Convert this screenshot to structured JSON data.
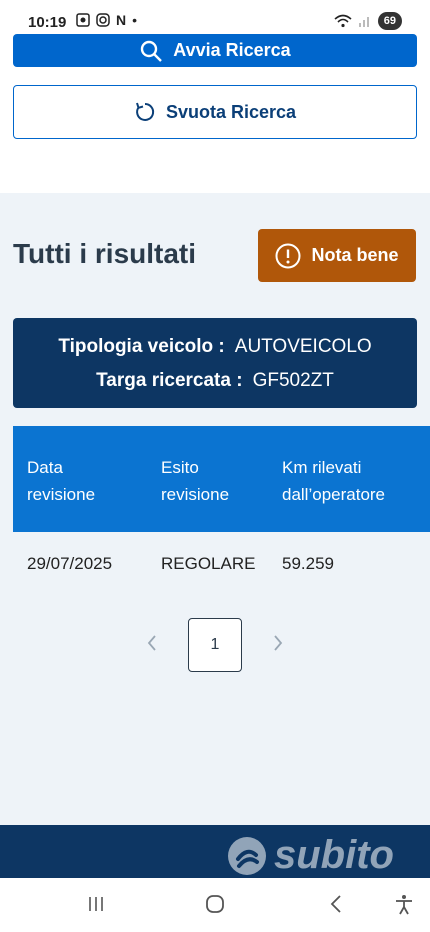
{
  "status_bar": {
    "time": "10:19",
    "notification_letter": "N",
    "notification_dot": "•",
    "battery": "69"
  },
  "search": {
    "start_label": "Avvia Ricerca",
    "clear_label": "Svuota Ricerca"
  },
  "results": {
    "title": "Tutti i risultati",
    "note_label": "Nota bene"
  },
  "vehicle": {
    "type_label": "Tipologia veicolo :",
    "type_value": "AUTOVEICOLO",
    "plate_label": "Targa ricercata :",
    "plate_value": "GF502ZT"
  },
  "table": {
    "headers": [
      "Data\nrevisione",
      "Esito\nrevisione",
      "Km rilevati\ndall’operatore"
    ],
    "rows": [
      [
        "29/07/2025",
        "REGOLARE",
        "59.259"
      ]
    ]
  },
  "pagination": {
    "current_page": "1"
  },
  "watermark": {
    "text": "subito"
  },
  "colors": {
    "primary": "#0066cc",
    "dark_navy": "#0d3663",
    "warning": "#b0570a",
    "table_header": "#0b74d1"
  }
}
